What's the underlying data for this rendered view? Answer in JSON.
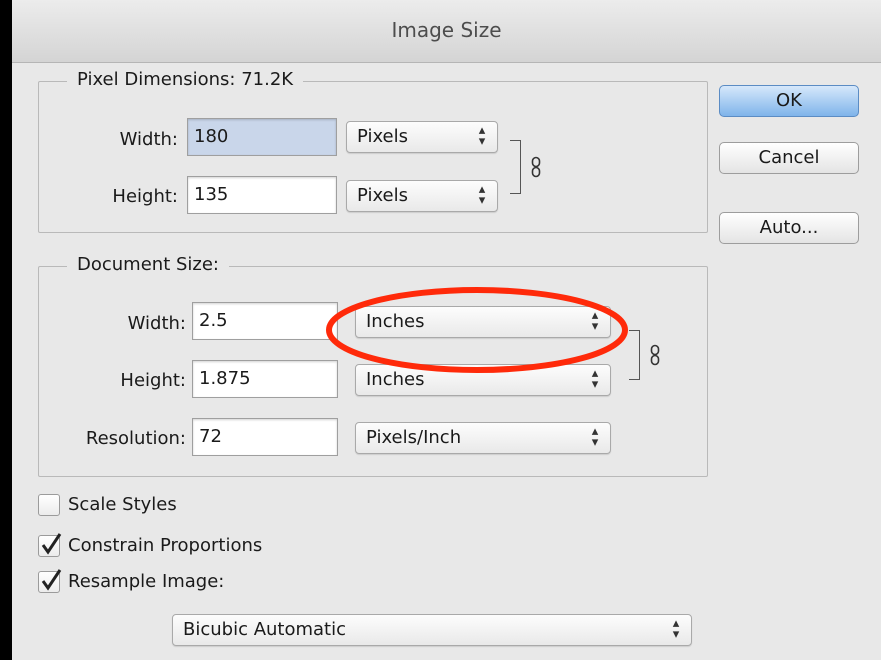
{
  "window": {
    "title": "Image Size"
  },
  "pixel_dimensions": {
    "legend": "Pixel Dimensions:",
    "size": "71.2K",
    "width": {
      "label": "Width:",
      "value": "180",
      "unit": "Pixels"
    },
    "height": {
      "label": "Height:",
      "value": "135",
      "unit": "Pixels"
    }
  },
  "document_size": {
    "legend": "Document Size:",
    "width": {
      "label": "Width:",
      "value": "2.5",
      "unit": "Inches"
    },
    "height": {
      "label": "Height:",
      "value": "1.875",
      "unit": "Inches"
    },
    "resolution": {
      "label": "Resolution:",
      "value": "72",
      "unit": "Pixels/Inch"
    }
  },
  "options": {
    "scale_styles": {
      "label": "Scale Styles",
      "checked": false
    },
    "constrain_proportions": {
      "label": "Constrain Proportions",
      "checked": true
    },
    "resample_image": {
      "label": "Resample Image:",
      "checked": true
    },
    "resample_method": "Bicubic Automatic"
  },
  "buttons": {
    "ok": "OK",
    "cancel": "Cancel",
    "auto": "Auto..."
  },
  "annotation": {
    "color": "#ff2a0a"
  }
}
